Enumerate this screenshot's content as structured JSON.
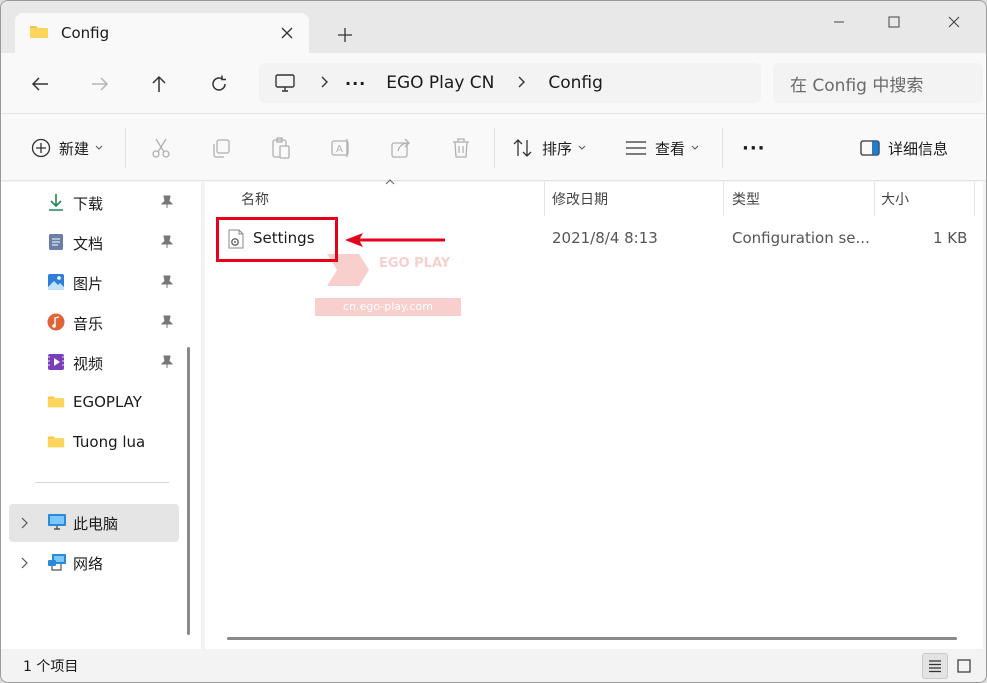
{
  "tab": {
    "title": "Config"
  },
  "address": {
    "crumbs": [
      "EGO Play CN",
      "Config"
    ],
    "overflow": "···"
  },
  "search": {
    "placeholder": "在 Config 中搜索"
  },
  "toolbar": {
    "new_label": "新建",
    "sort_label": "排序",
    "view_label": "查看",
    "more_label": "···",
    "details_label": "详细信息"
  },
  "sidebar": {
    "items": [
      {
        "label": "下载",
        "icon": "download-icon",
        "pinned": true
      },
      {
        "label": "文档",
        "icon": "documents-icon",
        "pinned": true
      },
      {
        "label": "图片",
        "icon": "pictures-icon",
        "pinned": true
      },
      {
        "label": "音乐",
        "icon": "music-icon",
        "pinned": true
      },
      {
        "label": "视频",
        "icon": "videos-icon",
        "pinned": true
      },
      {
        "label": "EGOPLAY",
        "icon": "folder-icon",
        "pinned": false
      },
      {
        "label": "Tuong lua",
        "icon": "folder-icon",
        "pinned": false
      }
    ],
    "this_pc": "此电脑",
    "network": "网络"
  },
  "columns": {
    "name": "名称",
    "modified": "修改日期",
    "type": "类型",
    "size": "大小"
  },
  "files": [
    {
      "name": "Settings",
      "modified": "2021/8/4 8:13",
      "type": "Configuration se...",
      "size": "1 KB"
    }
  ],
  "watermark": {
    "brand": "EGO PLAY",
    "url": "cn.ego-play.com"
  },
  "status": {
    "count": "1 个项目"
  },
  "colors": {
    "accent": "#0067c0",
    "highlight": "#e6001b",
    "folder": "#f4c542"
  }
}
